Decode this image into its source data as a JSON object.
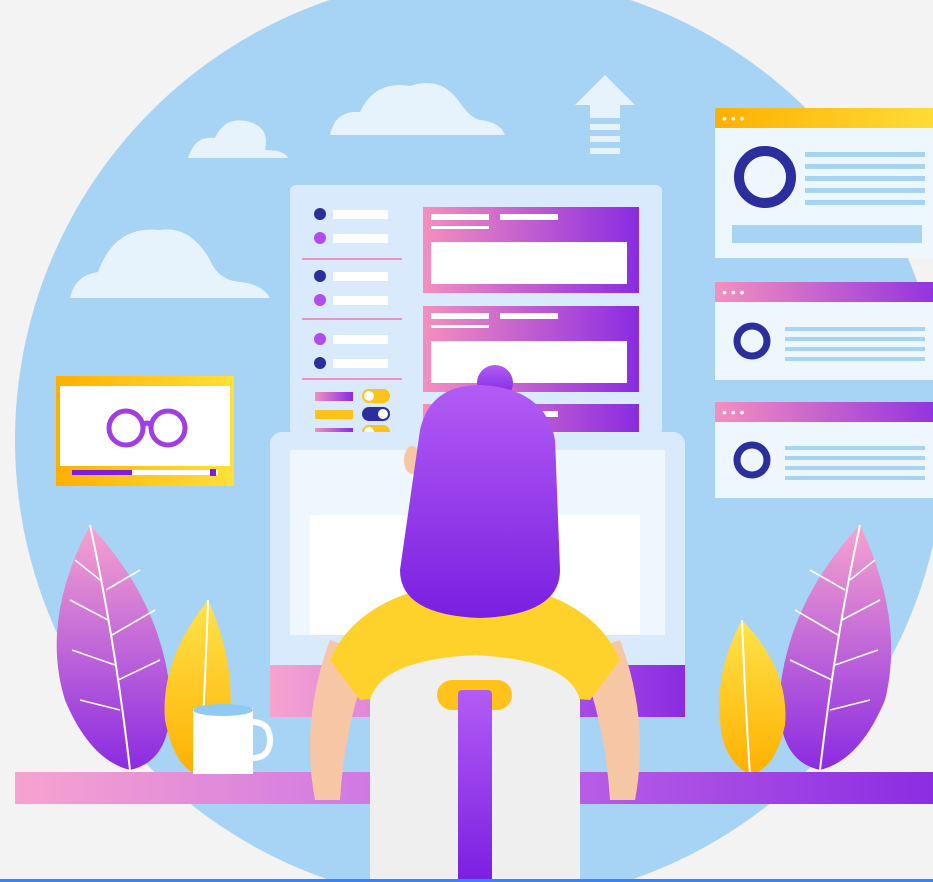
{
  "illustration": {
    "subject": "person-working-at-computer-dashboard-illustration",
    "colors": {
      "background": "#f3f3f3",
      "sky_circle": "#a7d3f5",
      "cloud": "#e6f2fc",
      "accent_purple": "#8a2be2",
      "accent_pink": "#f48fbf",
      "accent_yellow": "#ffd21f",
      "accent_orange": "#ffb000",
      "navy": "#2b2f9e",
      "skin": "#f7c6a5",
      "shirt": "#ffd12b",
      "bottom_rule": "#3b82f6"
    },
    "icons": [
      "cloud-icon",
      "upload-arrow-icon",
      "glasses-icon",
      "toggle-switch-icon",
      "circle-chart-icon",
      "coffee-mug-icon",
      "plant-leaf-icon"
    ],
    "panels": {
      "window_1": {
        "header_dots": "• • •",
        "header_color": "#ffc21a"
      },
      "window_2": {
        "header_dots": "• • •",
        "header_color": "#b14cf0"
      },
      "window_3": {
        "header_dots": "• • •",
        "header_color": "#b14cf0"
      }
    }
  }
}
